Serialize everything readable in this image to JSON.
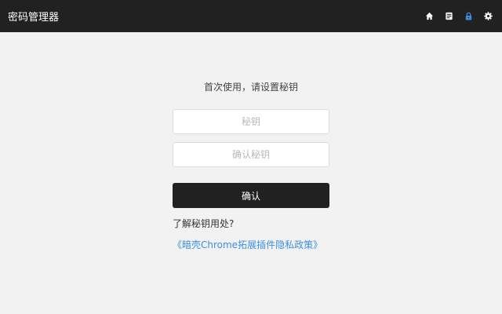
{
  "header": {
    "title": "密码管理器",
    "icons": [
      {
        "name": "home-icon",
        "color": "#ffffff"
      },
      {
        "name": "document-icon",
        "color": "#ffffff"
      },
      {
        "name": "lock-icon",
        "color": "#3d8fe0"
      },
      {
        "name": "gear-icon",
        "color": "#ffffff"
      }
    ]
  },
  "setup": {
    "prompt": "首次使用，请设置秘钥",
    "key_placeholder": "秘钥",
    "confirm_key_placeholder": "确认秘钥",
    "confirm_label": "确认",
    "help_link": "了解秘钥用处?",
    "policy_link": "《暗壳Chrome拓展插件隐私政策》"
  },
  "colors": {
    "topbar": "#212121",
    "background": "#f2f2f2",
    "accent": "#3d8fe0"
  }
}
